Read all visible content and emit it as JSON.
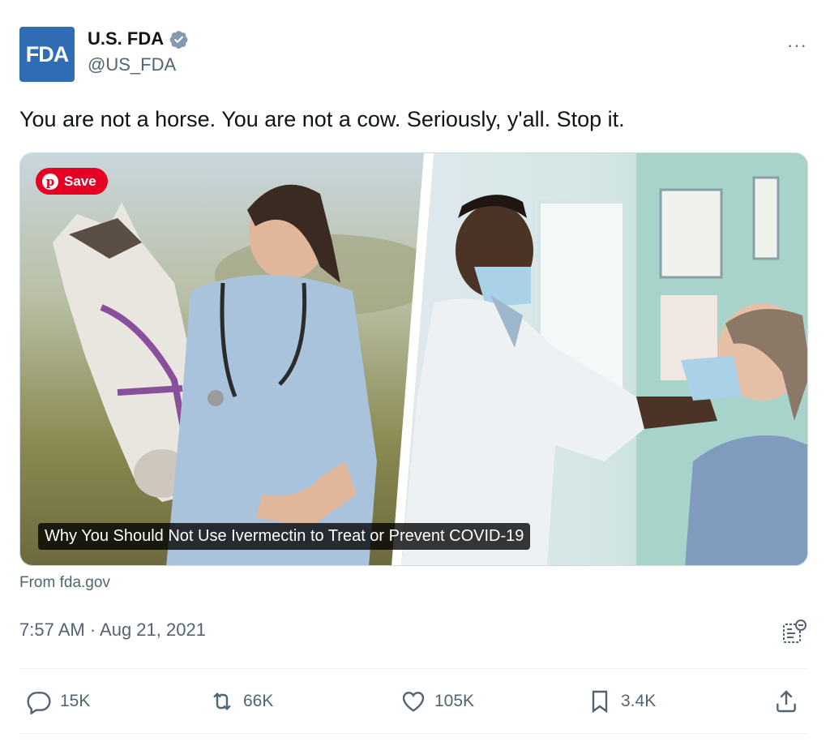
{
  "account": {
    "avatar_text": "FDA",
    "display_name": "U.S. FDA",
    "handle": "@US_FDA",
    "verified": true,
    "avatar_color": "#2f6cb3",
    "verified_color": "#829aab"
  },
  "more_menu": {
    "icon": "ellipsis-icon",
    "label": "···"
  },
  "tweet": {
    "text": "You are not a horse. You are not a cow. Seriously, y'all. Stop it."
  },
  "card": {
    "save_button": "Save",
    "save_color": "#e60023",
    "caption": "Why You Should Not Use Ivermectin to Treat or Prevent COVID-19",
    "source": "From fda.gov"
  },
  "meta": {
    "timestamp": "7:57 AM · Aug 21, 2021"
  },
  "actions": {
    "replies": "15K",
    "reposts": "66K",
    "likes": "105K",
    "bookmarks": "3.4K"
  }
}
